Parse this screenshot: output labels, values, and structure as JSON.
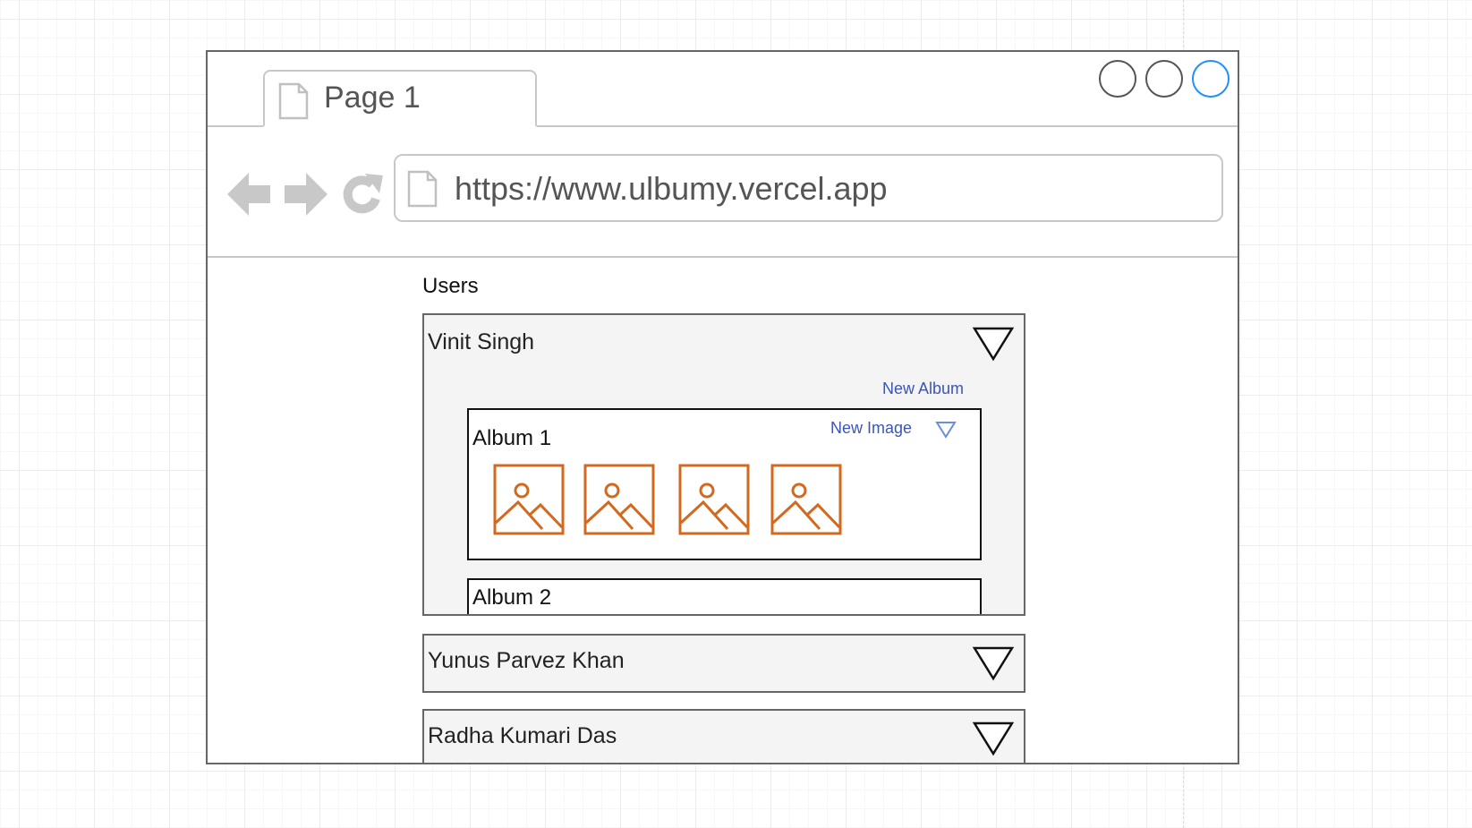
{
  "browser": {
    "tab": {
      "label": "Page 1"
    },
    "url": "https://www.ulbumy.vercel.app",
    "window_buttons": [
      "circle",
      "circle",
      "circle-highlighted"
    ],
    "accent_color": "#1e90ff"
  },
  "content": {
    "section_title": "Users",
    "users": [
      {
        "name": "Vinit Singh",
        "expanded": true,
        "new_album_label": "New Album",
        "albums": [
          {
            "title": "Album 1",
            "new_image_label": "New Image",
            "image_count": 4
          },
          {
            "title": "Album 2"
          }
        ]
      },
      {
        "name": "Yunus Parvez Khan",
        "expanded": false
      },
      {
        "name": "Radha Kumari Das",
        "expanded": false
      }
    ]
  },
  "colors": {
    "link": "#3c55b8",
    "image_icon": "#d2691e",
    "panel_bg": "#f4f4f4"
  },
  "icons": {
    "tab": "page-icon",
    "back": "arrow-left-icon",
    "forward": "arrow-right-icon",
    "reload": "reload-icon",
    "url": "page-icon",
    "expand": "triangle-down-icon",
    "image": "image-placeholder-icon"
  }
}
